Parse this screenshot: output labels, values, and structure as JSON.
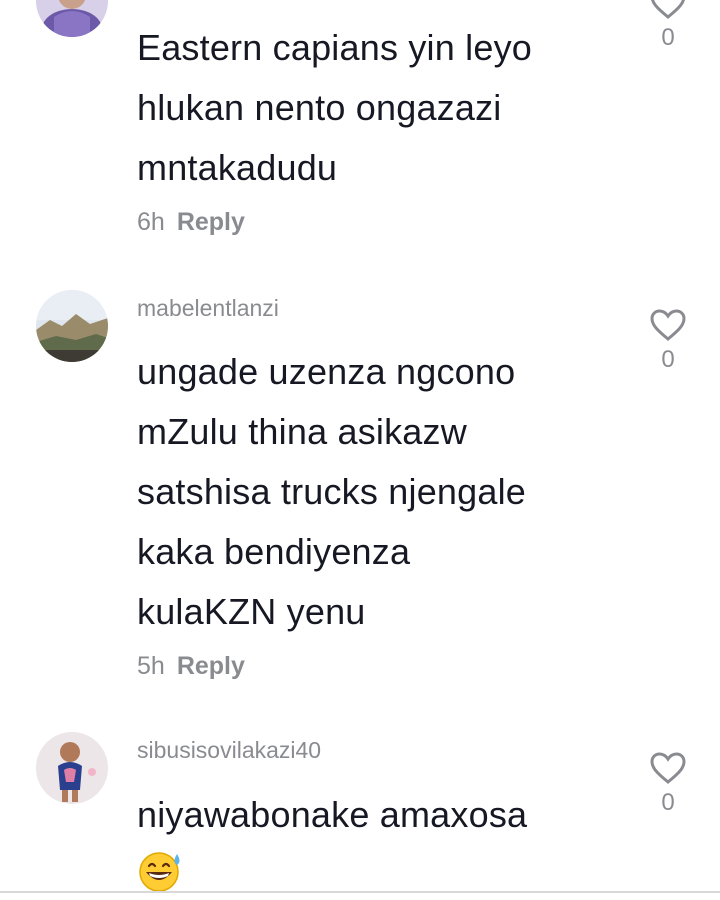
{
  "comments": [
    {
      "username": "",
      "text": "Eastern capians yin leyo\nhlukan nento ongazazi\nmntakadudu",
      "time": "6h",
      "reply_label": "Reply",
      "likes": "0"
    },
    {
      "username": "mabelentlanzi",
      "text": "ungade uzenza ngcono\nmZulu thina asikazw\nsatshisa trucks njengale\nkaka bendiyenza\nkulaKZN yenu",
      "time": "5h",
      "reply_label": "Reply",
      "likes": "0"
    },
    {
      "username": "sibusisovilakazi40",
      "text": "niyawabonake amaxosa",
      "emoji_icon": "grinning-sweat-emoji",
      "likes": "0"
    }
  ],
  "colors": {
    "text": "#161823",
    "muted": "#8a8b91",
    "like_icon": "#8a8b91",
    "divider": "#d8d8d8"
  }
}
